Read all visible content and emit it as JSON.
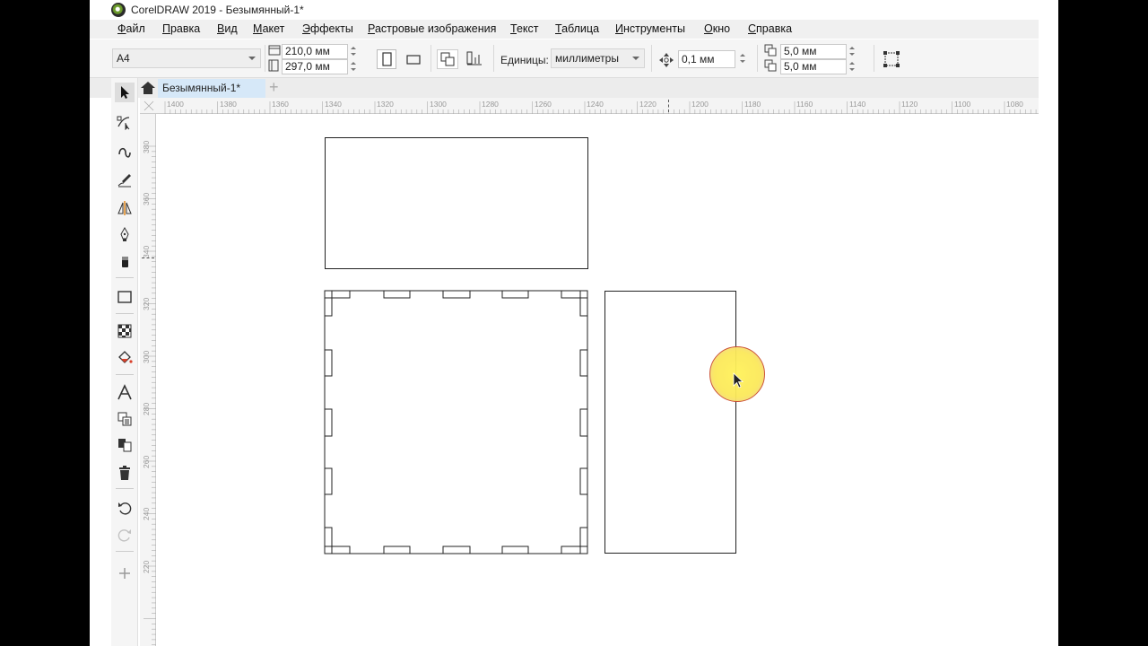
{
  "window": {
    "title": "CorelDRAW 2019 - Безымянный-1*"
  },
  "menu": [
    {
      "label": "Файл",
      "u": "Ф",
      "rest": "айл"
    },
    {
      "label": "Правка",
      "u": "П",
      "rest": "равка"
    },
    {
      "label": "Вид",
      "u": "В",
      "rest": "ид"
    },
    {
      "label": "Макет",
      "u": "М",
      "rest": "акет"
    },
    {
      "label": "Эффекты",
      "u": "Э",
      "rest": "ффекты"
    },
    {
      "label": "Растровые изображения",
      "u": "Р",
      "rest": "астровые изображения"
    },
    {
      "label": "Текст",
      "u": "Т",
      "rest": "екст"
    },
    {
      "label": "Таблица",
      "u": "Т",
      "rest": "аблица"
    },
    {
      "label": "Инструменты",
      "u": "И",
      "rest": "нструменты"
    },
    {
      "label": "Окно",
      "u": "О",
      "rest": "кно"
    },
    {
      "label": "Справка",
      "u": "С",
      "rest": "правка"
    }
  ],
  "propbar": {
    "page_size": "A4",
    "width": "210,0 мм",
    "height": "297,0 мм",
    "units_label": "Единицы:",
    "units_value": "миллиметры",
    "nudge": "0,1 мм",
    "dup_x": "5,0 мм",
    "dup_y": "5,0 мм"
  },
  "tabs": {
    "document": "Безымянный-1*"
  },
  "ruler_h": [
    "1400",
    "1380",
    "1360",
    "1340",
    "1320",
    "1300",
    "1280",
    "1260",
    "1240",
    "1220",
    "1200",
    "1180",
    "1160",
    "1140",
    "1120",
    "1100",
    "1080"
  ],
  "ruler_v": [
    "380",
    "360",
    "340",
    "320",
    "300",
    "280",
    "260",
    "240",
    "220"
  ],
  "colors": {
    "tab_active": "#d6e8f8",
    "cursor_highlight": "#fbe85a",
    "accent_red": "#c9492e"
  }
}
